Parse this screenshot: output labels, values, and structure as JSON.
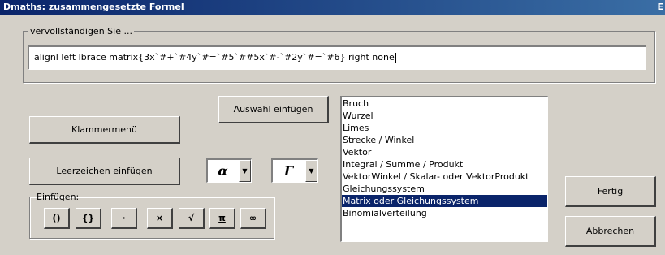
{
  "window": {
    "title": "Dmaths: zusammengesetzte Formel",
    "close_glyph": "E"
  },
  "formula_group": {
    "legend": "vervollständigen Sie ...",
    "value": "alignl left lbrace matrix{3x`#+`#4y`#=`#5`##5x`#-`#2y`#=`#6} right none"
  },
  "buttons": {
    "auswahl_einfuegen": "Auswahl einfügen",
    "klammermenue": "Klammermenü",
    "leerzeichen_einfuegen": "Leerzeichen einfügen",
    "fertig": "Fertig",
    "abbrechen": "Abbrechen"
  },
  "combos": {
    "greek_lower": "α",
    "greek_upper": "Γ",
    "arrow_glyph": "▼"
  },
  "insert_group": {
    "legend": "Einfügen:",
    "symbols": [
      "()",
      "{}",
      "·",
      "×",
      "√",
      "π",
      "∞"
    ]
  },
  "list": {
    "items": [
      "Bruch",
      "Wurzel",
      "Limes",
      "Strecke / Winkel",
      "Vektor",
      "Integral / Summe / Produkt",
      "VektorWinkel / Skalar- oder VektorProdukt",
      "Gleichungssystem",
      "Matrix oder Gleichungssystem",
      "Binomialverteilung"
    ],
    "selected_index": 8
  }
}
